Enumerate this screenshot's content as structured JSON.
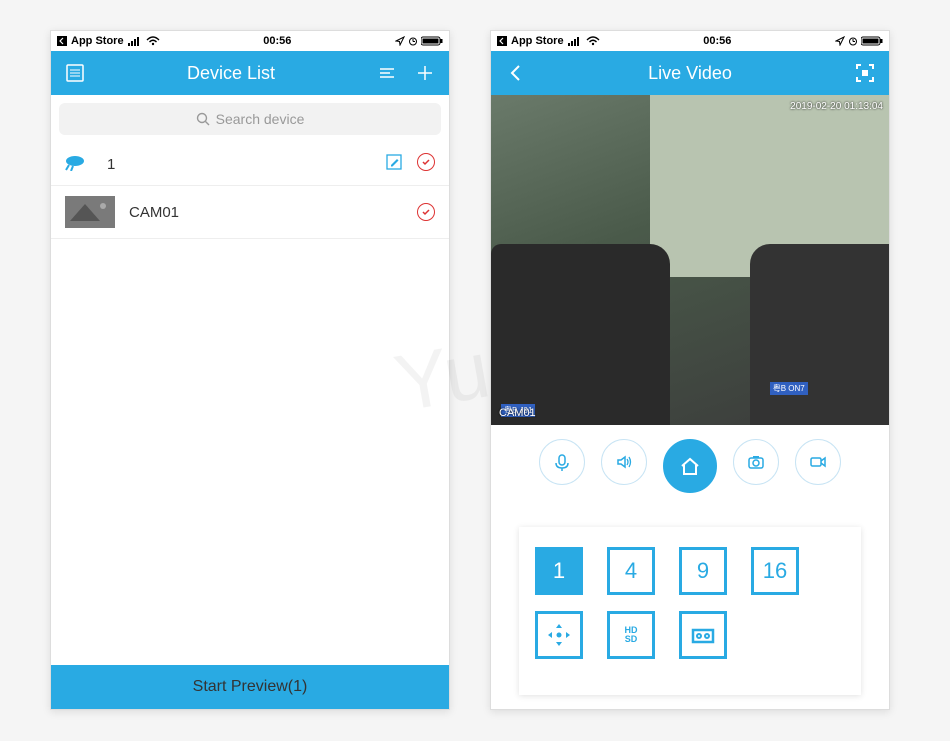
{
  "status": {
    "appstore": "App Store",
    "time": "00:56"
  },
  "left": {
    "header": {
      "title": "Device List"
    },
    "search": {
      "placeholder": "Search device"
    },
    "devices": [
      {
        "name": "1"
      },
      {
        "name": "CAM01"
      }
    ],
    "preview_button": "Start Preview(1)"
  },
  "right": {
    "header": {
      "title": "Live Video"
    },
    "video": {
      "timestamp": "2019-02-20 01:13:04",
      "camera_label": "CAM01",
      "plate1": "粤B  J91",
      "plate2": "粤B ON7"
    },
    "grid": {
      "opts": [
        "1",
        "4",
        "9",
        "16"
      ],
      "hd": "HD",
      "sd": "SD"
    }
  },
  "watermark": "Yum"
}
